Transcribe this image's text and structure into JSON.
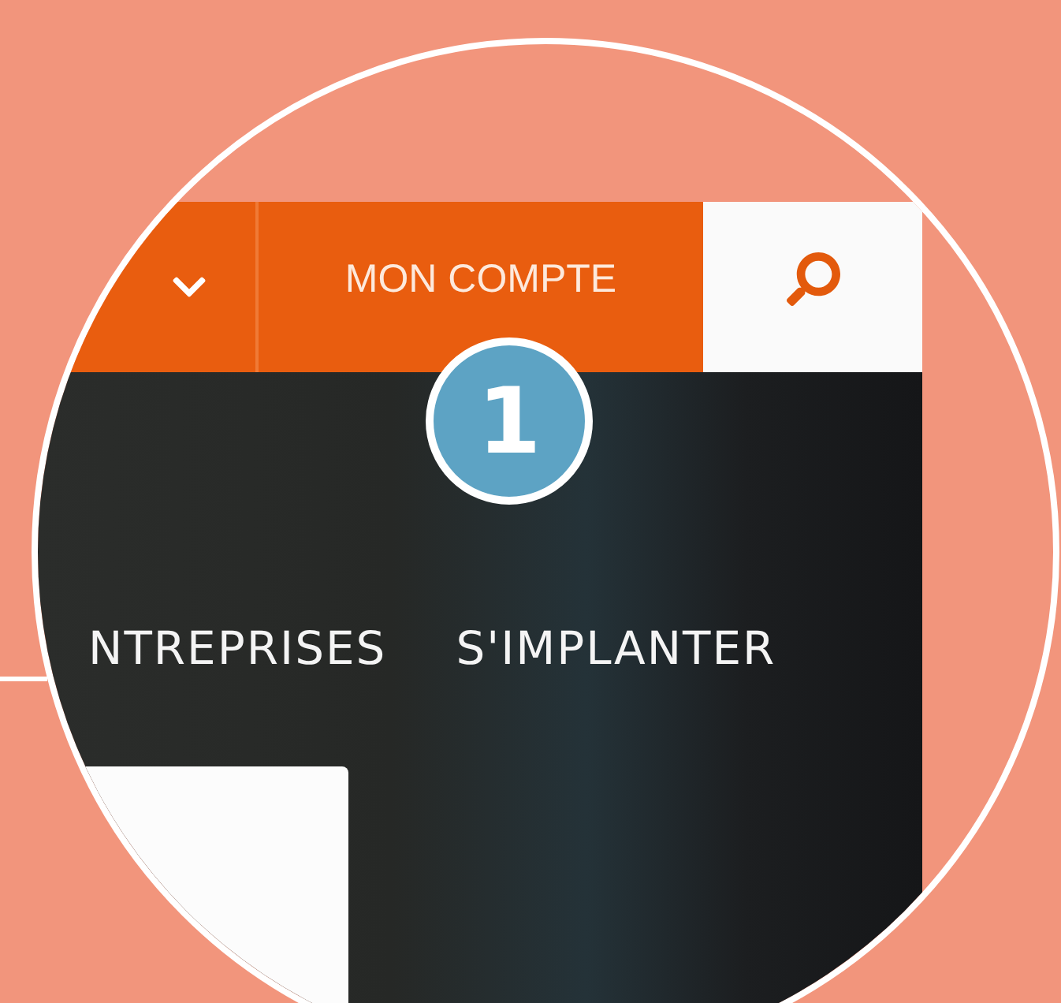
{
  "header": {
    "account_button": "MON COMPTE"
  },
  "nav": [
    "NTREPRISES",
    "S'IMPLANTER"
  ],
  "callout": {
    "number": "1"
  }
}
